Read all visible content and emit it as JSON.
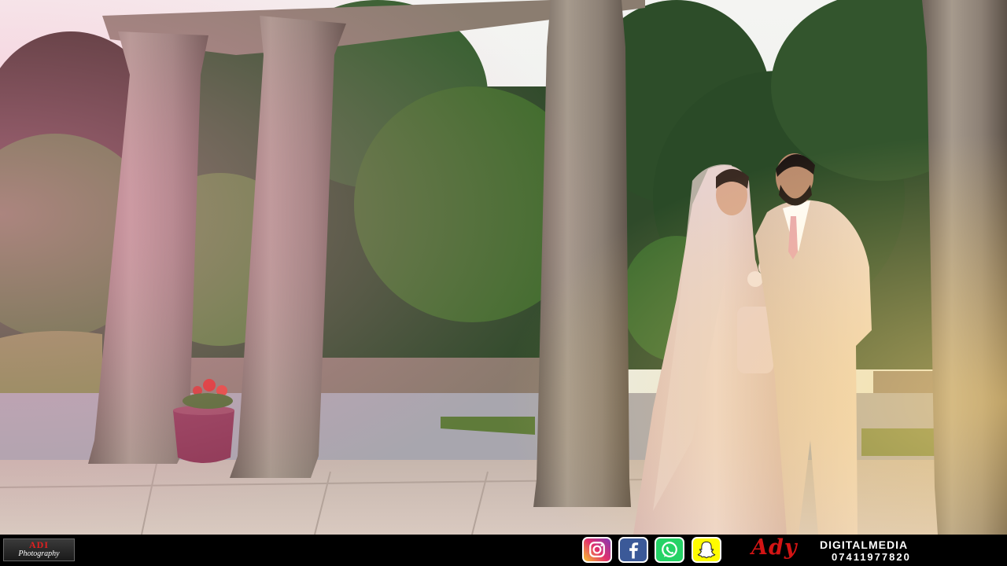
{
  "overlay": {
    "left_logo": {
      "line1": "ADI",
      "line2": "Photography"
    },
    "social_icons": [
      "instagram-icon",
      "facebook-icon",
      "whatsapp-icon",
      "snapchat-icon"
    ],
    "brand_mark": "Ady",
    "brand_name": "DIGITALMEDIA",
    "phone": "07411977820"
  },
  "colors": {
    "bar": "#000000",
    "brand_red": "#d31414",
    "instagram": "#e1306c",
    "facebook": "#3b5998",
    "whatsapp": "#25d366",
    "snapchat": "#fffc00"
  }
}
